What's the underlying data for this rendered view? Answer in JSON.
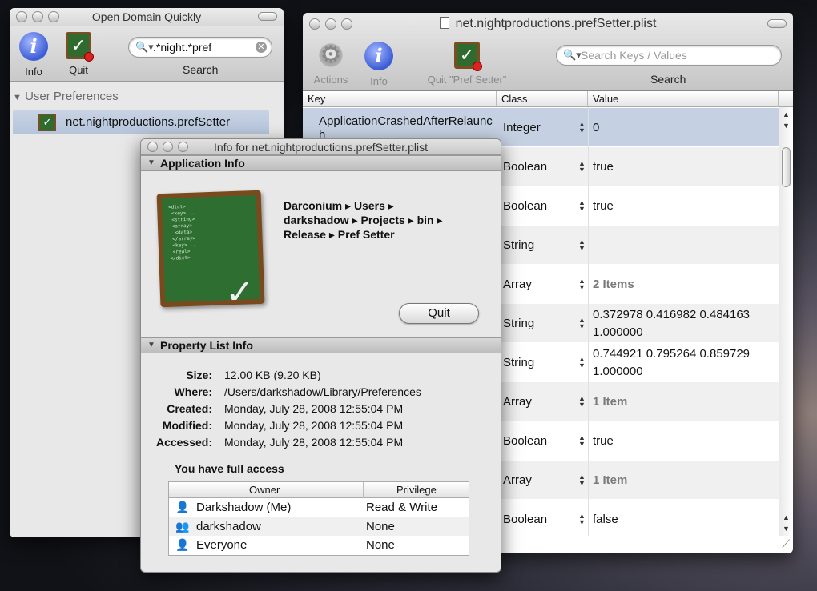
{
  "odq": {
    "title": "Open Domain Quickly",
    "toolbar": {
      "info_label": "Info",
      "quit_label": "Quit",
      "search_label": "Search",
      "search_value": ".*night.*pref"
    },
    "sidebar": {
      "header": "User Preferences",
      "items": [
        {
          "label": "net.nightproductions.prefSetter"
        }
      ]
    }
  },
  "plist": {
    "title": "net.nightproductions.prefSetter.plist",
    "toolbar": {
      "actions_label": "Actions",
      "info_label": "Info",
      "quit_label": "Quit \"Pref Setter\"",
      "search_label": "Search",
      "search_placeholder": "Search Keys / Values"
    },
    "columns": {
      "key": "Key",
      "class": "Class",
      "value": "Value"
    },
    "rows": [
      {
        "key": "ApplicationCrashedAfterRelaunch",
        "class": "Integer",
        "value": "0"
      },
      {
        "key": "",
        "class": "Boolean",
        "value": "true"
      },
      {
        "key": "",
        "class": "Boolean",
        "value": "true"
      },
      {
        "key": "",
        "class": "String",
        "value": ""
      },
      {
        "key": "",
        "class": "Array",
        "value": "2 Items"
      },
      {
        "key": "",
        "class": "String",
        "value": "0.372978 0.416982 0.484163 1.000000"
      },
      {
        "key": "",
        "class": "String",
        "value": "0.744921 0.795264 0.859729 1.000000"
      },
      {
        "key": "",
        "class": "Array",
        "value": "1 Item"
      },
      {
        "key": "",
        "class": "Boolean",
        "value": "true"
      },
      {
        "key": "",
        "class": "Array",
        "value": "1 Item"
      },
      {
        "key": "",
        "class": "Boolean",
        "value": "false"
      }
    ]
  },
  "info": {
    "title": "Info for net.nightproductions.prefSetter.plist",
    "app_section": "Application Info",
    "path_parts": [
      "Darconium",
      "Users",
      "darkshadow",
      "Projects",
      "bin",
      "Release",
      "Pref Setter"
    ],
    "quit_label": "Quit",
    "plist_section": "Property List Info",
    "size_label": "Size:",
    "size": "12.00 KB (9.20 KB)",
    "where_label": "Where:",
    "where": "/Users/darkshadow/Library/Preferences",
    "created_label": "Created:",
    "created": "Monday, July 28, 2008 12:55:04 PM",
    "modified_label": "Modified:",
    "modified": "Monday, July 28, 2008 12:55:04 PM",
    "accessed_label": "Accessed:",
    "accessed": "Monday, July 28, 2008 12:55:04 PM",
    "access_title": "You have full access",
    "perm_headers": {
      "owner": "Owner",
      "privilege": "Privilege"
    },
    "permissions": [
      {
        "name": "Darkshadow (Me)",
        "privilege": "Read & Write",
        "icon": "user-icon"
      },
      {
        "name": "darkshadow",
        "privilege": "None",
        "icon": "group-icon"
      },
      {
        "name": "Everyone",
        "privilege": "None",
        "icon": "everyone-icon"
      }
    ]
  }
}
